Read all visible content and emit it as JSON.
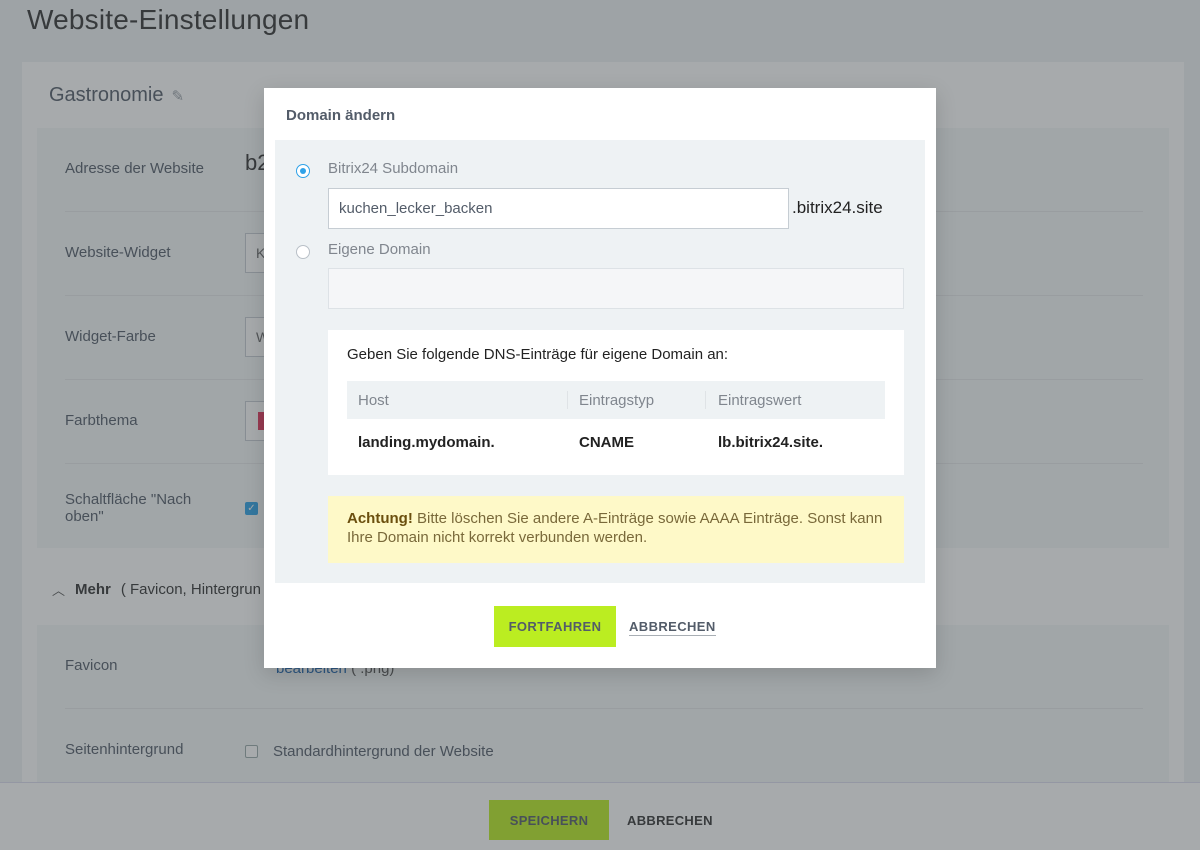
{
  "page": {
    "title": "Website-Einstellungen",
    "site_name": "Gastronomie"
  },
  "settings": {
    "rows": [
      {
        "label": "Adresse der Website",
        "value": "b2"
      },
      {
        "label": "Website-Widget",
        "value": "K"
      },
      {
        "label": "Widget-Farbe",
        "value": "W"
      },
      {
        "label": "Farbthema",
        "value": ""
      },
      {
        "label": "Schaltfläche \"Nach oben\"",
        "value": ""
      }
    ],
    "theme_color": "#e2345a",
    "mehr_label": "Mehr",
    "mehr_items": "( Favicon,  Hintergrun",
    "favicon_label": "Favicon",
    "favicon_link": "bearbeiten",
    "favicon_hint": "( .png)",
    "background_label": "Seitenhintergrund",
    "background_option": "Standardhintergrund der Website"
  },
  "bottom": {
    "save": "SPEICHERN",
    "cancel": "ABBRECHEN"
  },
  "modal": {
    "title": "Domain ändern",
    "option_subdomain": "Bitrix24 Subdomain",
    "subdomain_value": "kuchen_lecker_backen",
    "subdomain_suffix": ".bitrix24.site",
    "option_custom": "Eigene Domain",
    "custom_value": "",
    "dns_intro": "Geben Sie folgende DNS-Einträge für eigene Domain an:",
    "dns_headers": {
      "host": "Host",
      "type": "Eintragstyp",
      "value": "Eintragswert"
    },
    "dns_row": {
      "host": "landing.mydomain.",
      "type": "CNAME",
      "value": "lb.bitrix24.site."
    },
    "warning_strong": "Achtung!",
    "warning_text": "Bitte löschen Sie andere A-Einträge sowie AAAA Einträge. Sonst kann Ihre Domain nicht korrekt verbunden werden.",
    "continue": "FORTFAHREN",
    "cancel": "ABBRECHEN"
  },
  "colors": {
    "accent_green": "#bbed21",
    "radio_blue": "#2fa2e8",
    "warning_bg": "#fef9c8"
  }
}
